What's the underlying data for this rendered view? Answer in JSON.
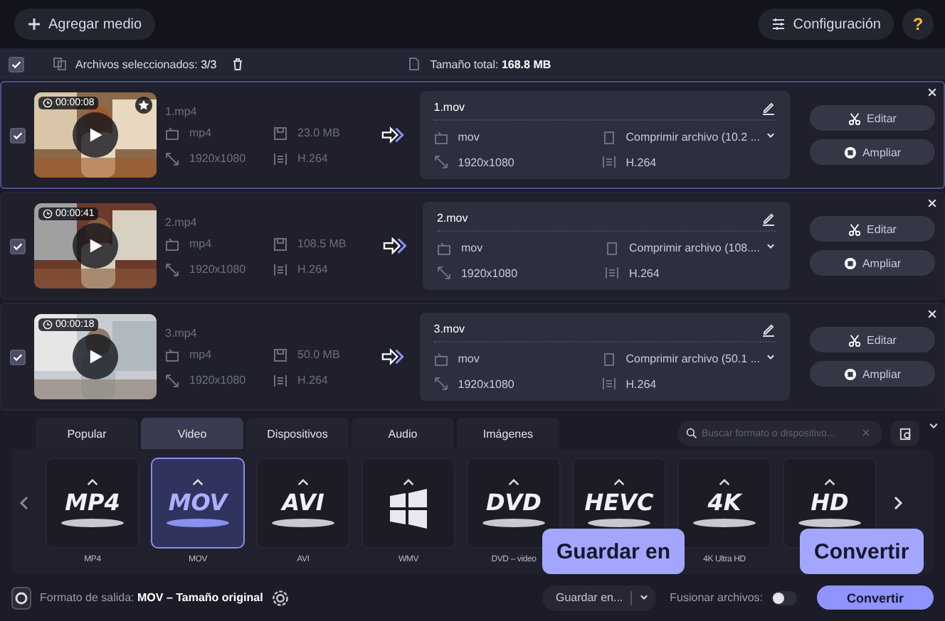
{
  "toolbar": {
    "add_button": "Agregar medio",
    "settings_button": "Configuración",
    "help_button": "?"
  },
  "selection_bar": {
    "checked": true,
    "selected_label": "Archivos seleccionados:",
    "selected_count": "3/3",
    "total_label": "Tamaño total:",
    "total_value": "168.8 MB"
  },
  "files": [
    {
      "checked": true,
      "selected": true,
      "starred": true,
      "duration": "00:00:08",
      "source": {
        "name": "1.mp4",
        "format": "mp4",
        "size": "23.0 MB",
        "resolution": "1920x1080",
        "codec": "H.264"
      },
      "output": {
        "name": "1.mov",
        "format": "mov",
        "compression": "Comprimir archivo (10.2 ...",
        "resolution": "1920x1080",
        "codec": "H.264"
      },
      "edit_button": "Editar",
      "upscale_button": "Ampliar"
    },
    {
      "checked": true,
      "selected": false,
      "starred": false,
      "duration": "00:00:41",
      "source": {
        "name": "2.mp4",
        "format": "mp4",
        "size": "108.5 MB",
        "resolution": "1920x1080",
        "codec": "H.264"
      },
      "output": {
        "name": "2.mov",
        "format": "mov",
        "compression": "Comprimir archivo (108....",
        "resolution": "1920x1080",
        "codec": "H.264"
      },
      "edit_button": "Editar",
      "upscale_button": "Ampliar"
    },
    {
      "checked": true,
      "selected": false,
      "starred": false,
      "duration": "00:00:18",
      "source": {
        "name": "3.mp4",
        "format": "mp4",
        "size": "50.0 MB",
        "resolution": "1920x1080",
        "codec": "H.264"
      },
      "output": {
        "name": "3.mov",
        "format": "mov",
        "compression": "Comprimir archivo (50.1 ...",
        "resolution": "1920x1080",
        "codec": "H.264"
      },
      "edit_button": "Editar",
      "upscale_button": "Ampliar"
    }
  ],
  "category_tabs": [
    {
      "label": "Popular",
      "selected": false
    },
    {
      "label": "Video",
      "selected": true
    },
    {
      "label": "Dispositivos",
      "selected": false
    },
    {
      "label": "Audio",
      "selected": false
    },
    {
      "label": "Imágenes",
      "selected": false
    }
  ],
  "search": {
    "placeholder": "Buscar formato o dispositivo..."
  },
  "formats": [
    {
      "kind": "logo",
      "logo": "MP4",
      "label": "MP4",
      "selected": false
    },
    {
      "kind": "logo",
      "logo": "MOV",
      "label": "MOV",
      "selected": true
    },
    {
      "kind": "logo",
      "logo": "AVI",
      "label": "AVI",
      "selected": false
    },
    {
      "kind": "windows",
      "label": "WMV",
      "selected": false
    },
    {
      "kind": "logo",
      "logo": "DVD",
      "label": "DVD – video",
      "selected": false
    },
    {
      "kind": "logo",
      "logo": "HEVC",
      "selected": false
    },
    {
      "kind": "logo",
      "logo": "4K",
      "label": "4K Ultra HD",
      "selected": false
    },
    {
      "kind": "logo",
      "logo": "HD",
      "selected": false
    }
  ],
  "footer": {
    "output_label": "Formato de salida:",
    "output_value": "MOV – Tamaño original",
    "save_button": "Guardar en...",
    "merge_label": "Fusionar archivos:",
    "merge_on": false,
    "convert_button": "Convertir"
  },
  "callouts": [
    "Guardar en",
    "Convertir"
  ]
}
